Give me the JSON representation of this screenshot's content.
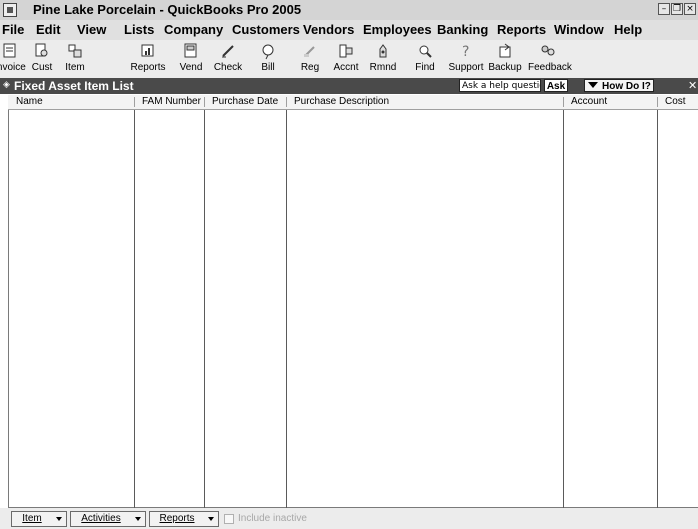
{
  "window": {
    "title": "Pine Lake Porcelain - QuickBooks Pro 2005",
    "controls": [
      "minimize-icon",
      "restore-icon",
      "close-icon"
    ]
  },
  "menu": [
    "File",
    "Edit",
    "View",
    "Lists",
    "Company",
    "Customers",
    "Vendors",
    "Employees",
    "Banking",
    "Reports",
    "Window",
    "Help"
  ],
  "toolbar": [
    {
      "label": "Invoice",
      "icon": "invoice-icon"
    },
    {
      "label": "Cust",
      "icon": "customer-icon"
    },
    {
      "label": "Item",
      "icon": "item-icon"
    },
    {
      "label": "Reports",
      "icon": "reports-icon"
    },
    {
      "label": "Vend",
      "icon": "vendor-icon"
    },
    {
      "label": "Check",
      "icon": "check-icon"
    },
    {
      "label": "Bill",
      "icon": "bill-icon"
    },
    {
      "label": "Reg",
      "icon": "register-icon"
    },
    {
      "label": "Accnt",
      "icon": "account-icon"
    },
    {
      "label": "Rmnd",
      "icon": "reminder-icon"
    },
    {
      "label": "Find",
      "icon": "find-icon"
    },
    {
      "label": "Support",
      "icon": "support-icon"
    },
    {
      "label": "Backup",
      "icon": "backup-icon"
    },
    {
      "label": "Feedback",
      "icon": "feedback-icon"
    }
  ],
  "list_window": {
    "title": "Fixed Asset Item List",
    "help_question_placeholder": "Ask a help question",
    "ask_label": "Ask",
    "how_do_i_label": "How Do I?"
  },
  "columns": [
    "Name",
    "FAM Number",
    "Purchase Date",
    "Purchase Description",
    "Account",
    "Cost"
  ],
  "bottom": {
    "item_button": "Item",
    "activities_button": "Activities",
    "reports_button": "Reports",
    "include_inactive_label": "Include inactive",
    "include_inactive_checked": false
  },
  "colors": {
    "list_title_bar": "#4a4a4a",
    "chrome": "#e0e0e0"
  }
}
